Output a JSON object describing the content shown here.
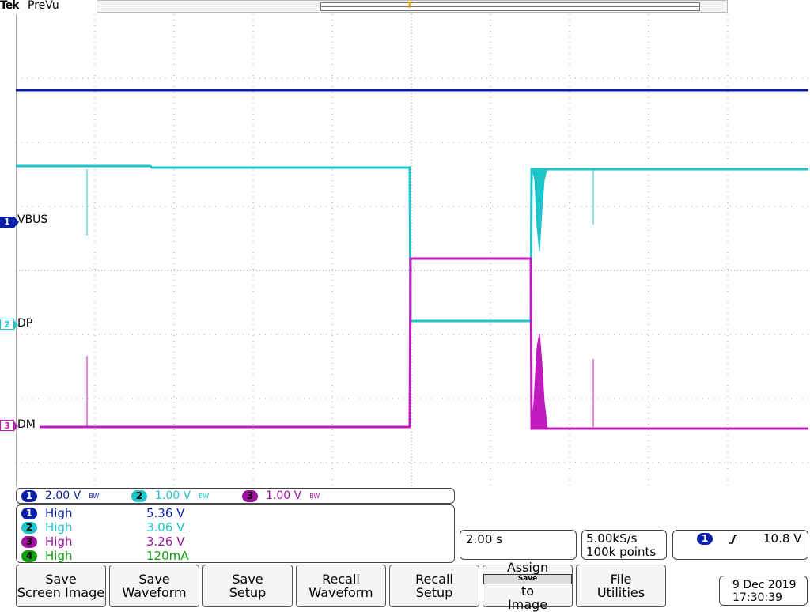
{
  "header": {
    "brand": "Tek",
    "mode": "PreVu",
    "trigger_marker": "T"
  },
  "channels": [
    {
      "id": "1",
      "label": "VBUS",
      "color": "#0a1fa8"
    },
    {
      "id": "2",
      "label": "DP",
      "color": "#1fc4c8"
    },
    {
      "id": "3",
      "label": "DM",
      "color": "#c01bbf"
    },
    {
      "id": "4",
      "color": "#10a010"
    }
  ],
  "scale": [
    {
      "ch": "1",
      "value": "2.00 V",
      "bw": "BW"
    },
    {
      "ch": "2",
      "value": "1.00 V",
      "bw": "BW"
    },
    {
      "ch": "3",
      "value": "1.00 V",
      "bw": "BW"
    }
  ],
  "measurements": [
    {
      "ch": "1",
      "name": "High",
      "value": "5.36 V"
    },
    {
      "ch": "2",
      "name": "High",
      "value": "3.06 V"
    },
    {
      "ch": "3",
      "name": "High",
      "value": "3.26 V"
    },
    {
      "ch": "4",
      "name": "High",
      "value": "120mA"
    }
  ],
  "timebase": {
    "scale": "2.00 s",
    "sample_rate": "5.00kS/s",
    "record_length": "100k points"
  },
  "trigger": {
    "source": "1",
    "slope_icon": "rising-edge-icon",
    "level": "10.8 V"
  },
  "menu": {
    "b1_l1": "Save",
    "b1_l2": "Screen Image",
    "b2_l1": "Save",
    "b2_l2": "Waveform",
    "b3_l1": "Save",
    "b3_l2": "Setup",
    "b4_l1": "Recall",
    "b4_l2": "Waveform",
    "b5_l1": "Recall",
    "b5_l2": "Setup",
    "b6_l1": "Assign",
    "b6_chip": "Save",
    "b6_to": "to",
    "b6_l3": "Image",
    "b7_l1": "File",
    "b7_l2": "Utilities"
  },
  "datetime": {
    "date": "9 Dec  2019",
    "time": "17:30:39"
  },
  "colors": {
    "grid": "#777777",
    "background": "#ffffff",
    "trigger": "#f0a000"
  }
}
